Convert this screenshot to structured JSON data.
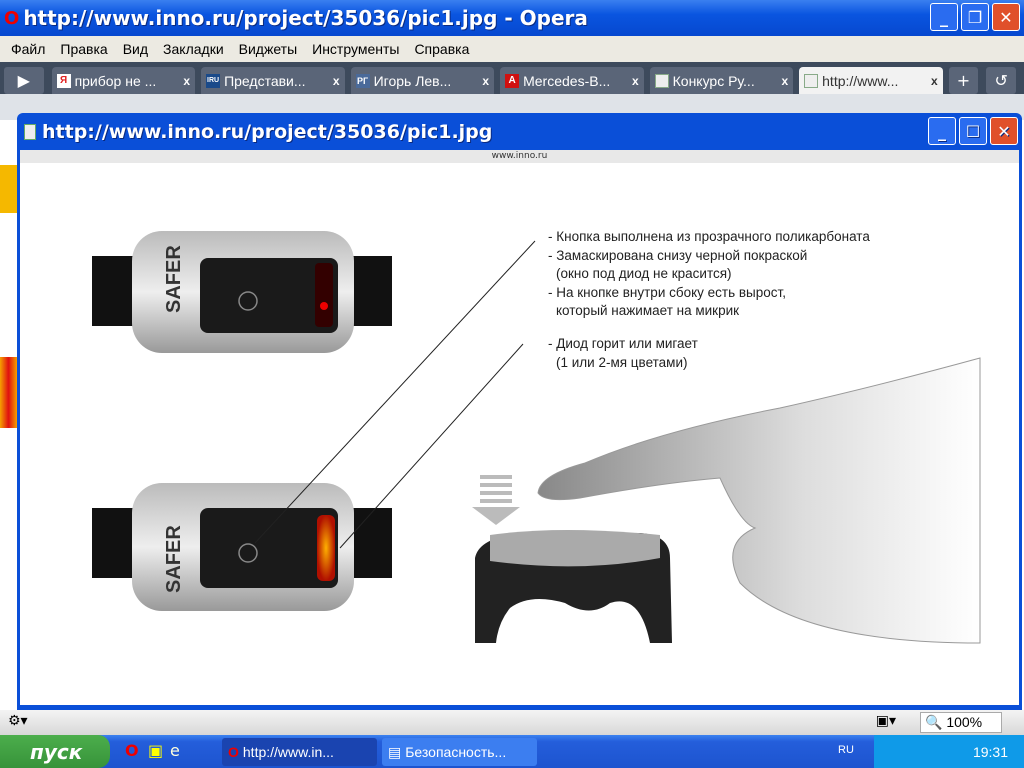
{
  "main_window": {
    "title": "http://www.inno.ru/project/35036/pic1.jpg - Opera"
  },
  "menu": [
    "Файл",
    "Правка",
    "Вид",
    "Закладки",
    "Виджеты",
    "Инструменты",
    "Справка"
  ],
  "tabs": [
    {
      "label": "прибор не ...",
      "icon": "yandex-icon",
      "color": "#e02020",
      "glyph": "Я"
    },
    {
      "label": "Представи...",
      "icon": "iru-icon",
      "color": "#1a4a8a",
      "glyph": "IRU"
    },
    {
      "label": "Игорь Лев...",
      "icon": "rg-icon",
      "color": "#4a6a9a",
      "glyph": "РГ"
    },
    {
      "label": "Mercedes-B...",
      "icon": "a-icon",
      "color": "#d01010",
      "glyph": "A"
    },
    {
      "label": "Конкурс Ру...",
      "icon": "page-icon",
      "color": "#eee",
      "glyph": ""
    },
    {
      "label": "http://www...",
      "icon": "page-icon",
      "color": "#eee",
      "glyph": ""
    }
  ],
  "popup": {
    "title": "http://www.inno.ru/project/35036/pic1.jpg",
    "site": "www.inno.ru"
  },
  "image": {
    "brand": "SAFER",
    "notes1": [
      "- Кнопка выполнена из прозрачного поликарбоната",
      "- Замаскирована снизу черной покраской",
      "  (окно под диод не красится)",
      "- На кнопке внутри сбоку есть вырост,",
      "  который нажимает на микрик"
    ],
    "notes2": [
      "- Диод горит или мигает",
      "  (1 или 2-мя цветами)"
    ]
  },
  "status": {
    "zoom": "100%"
  },
  "taskbar": {
    "start": "пуск",
    "tasks": [
      "http://www.in...",
      "Безопасность..."
    ],
    "lang": "RU",
    "time": "19:31"
  }
}
